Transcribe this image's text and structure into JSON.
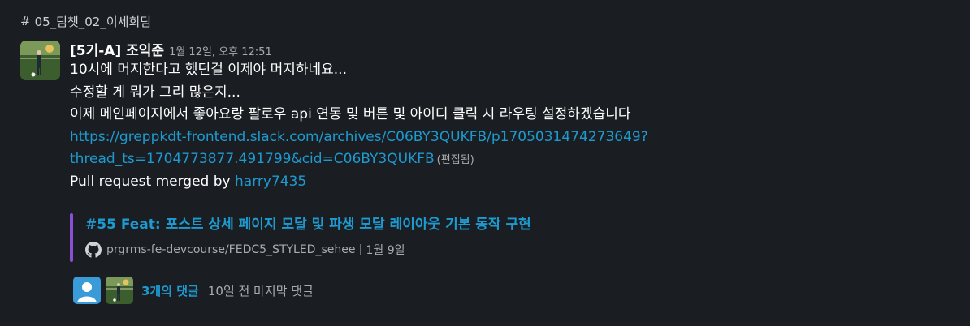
{
  "channel": {
    "name": "05_팀챗_02_이세희팀"
  },
  "message": {
    "sender": "[5기-A] 조익준",
    "timestamp": "1월 12일, 오후 12:51",
    "lines": [
      "10시에 머지한다고 했던걸 이제야 머지하네요...",
      "수정할 게 뭐가 그리 많은지...",
      "이제 메인페이지에서 좋아요랑 팔로우 api 연동 및 버튼 및 아이디 클릭 시 라우팅 설정하겠습니다"
    ],
    "link_line1": "https://greppkdt-frontend.slack.com/archives/C06BY3QUKFB/p1705031474273649?",
    "link_line2": "thread_ts=1704773877.491799&cid=C06BY3QUKFB",
    "edited_label": "(편집됨)",
    "pr_text": "Pull request merged by ",
    "pr_user": "harry7435"
  },
  "attachment": {
    "title": "#55 Feat: 포스트 상세 페이지 모달 및 파생 모달 레이아웃 기본 동작 구현",
    "repo": "prgrms-fe-devcourse/FEDC5_STYLED_sehee",
    "date": "1월 9일",
    "bar_color": "#8a4fd6"
  },
  "thread": {
    "reply_count": "3개의 댓글",
    "last_reply": "10일 전 마지막 댓글"
  },
  "icons": {
    "hash": "hash-icon",
    "github": "github-icon"
  },
  "colors": {
    "background": "#1a1d21",
    "link": "#1d9bd1",
    "text": "#ffffff",
    "muted": "#ababad"
  }
}
